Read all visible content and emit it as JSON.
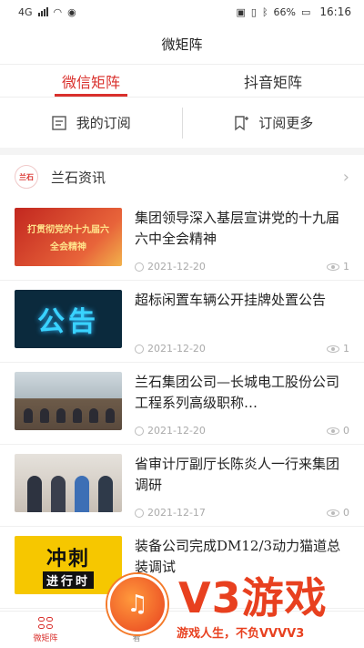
{
  "status_bar": {
    "left_text": "4G",
    "battery": "66%",
    "time": "16:16"
  },
  "header": {
    "title": "微矩阵"
  },
  "tabs": [
    {
      "label": "微信矩阵",
      "active": true
    },
    {
      "label": "抖音矩阵",
      "active": false
    }
  ],
  "subscribe": {
    "mine_label": "我的订阅",
    "more_label": "订阅更多"
  },
  "section": {
    "title": "兰石资讯",
    "logo_text": "兰石"
  },
  "articles": [
    {
      "title": "集团领导深入基层宣讲党的十九届六中全会精神",
      "date": "2021-12-20",
      "views": "1",
      "thumb_line1": "打贯彻党的十九届六",
      "thumb_line2": "全会精神"
    },
    {
      "title": "超标闲置车辆公开挂牌处置公告",
      "date": "2021-12-20",
      "views": "1",
      "thumb_text": "公告"
    },
    {
      "title": "兰石集团公司—长城电工股份公司工程系列高级职称…",
      "date": "2021-12-20",
      "views": "0"
    },
    {
      "title": "省审计厅副厅长陈炎人一行来集团调研",
      "date": "2021-12-17",
      "views": "0"
    },
    {
      "title": "装备公司完成DM12/3动力猫道总装调试",
      "date": "",
      "views": "",
      "thumb_line1": "冲刺",
      "thumb_line2": "进行时"
    }
  ],
  "bottom_nav": [
    {
      "label": "微矩阵",
      "active": true
    },
    {
      "label": "看",
      "active": false
    }
  ],
  "watermark": {
    "brand": "V3游戏",
    "tagline": "游戏人生，不负VVVV3"
  },
  "colors": {
    "accent": "#d9302c"
  }
}
